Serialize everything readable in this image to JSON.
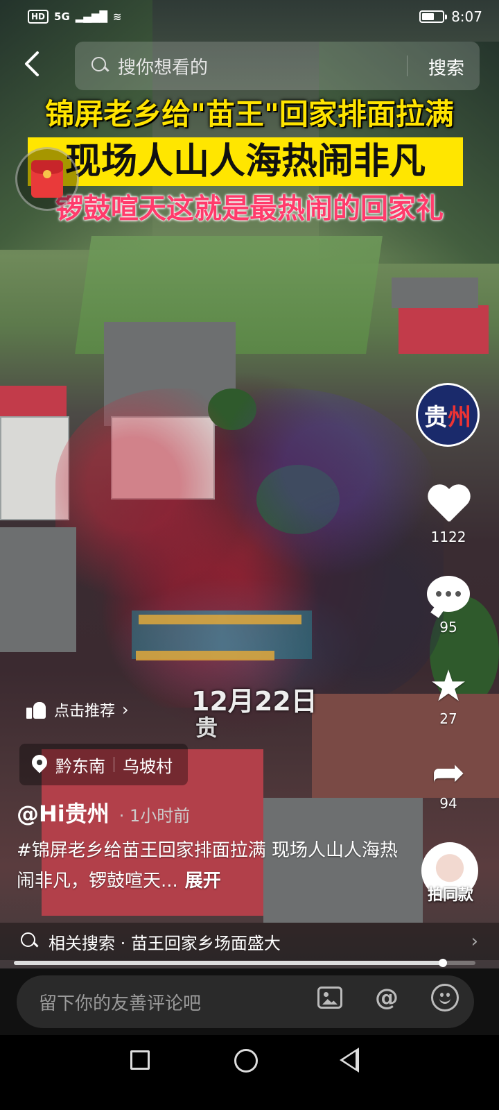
{
  "status_bar": {
    "network_badge": "HD",
    "network_type": "5G",
    "time": "8:07",
    "battery_level": 0.6
  },
  "header": {
    "back_icon": "back-chevron-icon",
    "search_placeholder": "搜你想看的",
    "search_button": "搜索"
  },
  "video": {
    "caption_line1": "锦屏老乡给\"苗王\"回家排面拉满",
    "caption_line2": "现场人山人海热闹非凡",
    "caption_line3": "锣鼓喧天这就是最热闹的回家礼",
    "date_overlay": "12月22日",
    "date_overlay_sub": "贵"
  },
  "side_actions": {
    "author_avatar_text_1": "贵",
    "author_avatar_text_2": "州",
    "like_count": "1122",
    "comment_count": "95",
    "favorite_count": "27",
    "share_count": "94",
    "same_style_label": "拍同款"
  },
  "info": {
    "recommend_label": "点击推荐",
    "location_region": "黔东南",
    "location_place": "乌坡村",
    "author_name": "@Hi贵州",
    "post_time": "· 1小时前",
    "description": "#锦屏老乡给苗王回家排面拉满 现场人山人海热闹非凡，锣鼓喧天...",
    "expand_label": "展开",
    "related_search": "相关搜索 · 苗王回家乡场面盛大"
  },
  "playback": {
    "progress": 0.93
  },
  "comment_bar": {
    "placeholder": "留下你的友善评论吧",
    "mention_symbol": "@"
  },
  "colors": {
    "caption_yellow": "#ffe400",
    "caption_pink": "#ff3b6b",
    "banner_bg": "#ffe600"
  }
}
